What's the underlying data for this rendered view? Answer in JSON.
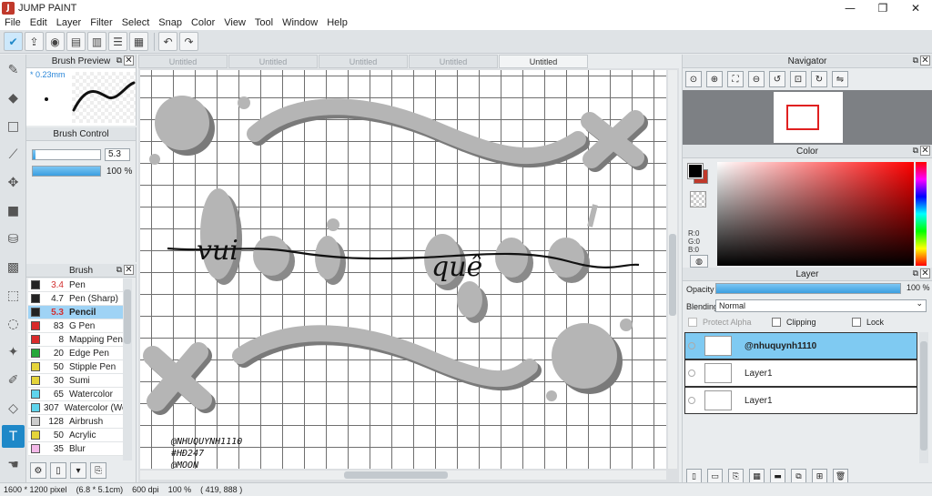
{
  "window": {
    "title": "JUMP PAINT",
    "controls": [
      "—",
      "❐",
      "✕"
    ]
  },
  "menu": [
    "File",
    "Edit",
    "Layer",
    "Filter",
    "Select",
    "Snap",
    "Color",
    "View",
    "Tool",
    "Window",
    "Help"
  ],
  "brush_preview": {
    "title": "Brush Preview",
    "size_label": "* 0.23mm"
  },
  "brush_control": {
    "title": "Brush Control",
    "size_value": "5.3",
    "opacity_value": "100 %"
  },
  "brush_list": {
    "title": "Brush",
    "items": [
      {
        "size": "3.4",
        "name": "Pen",
        "color": "#222222",
        "red": true
      },
      {
        "size": "4.7",
        "name": "Pen (Sharp)",
        "color": "#222222",
        "red": false
      },
      {
        "size": "5.3",
        "name": "Pencil",
        "color": "#222222",
        "red": true,
        "selected": true
      },
      {
        "size": "83",
        "name": "G Pen",
        "color": "#d92b2b",
        "red": false
      },
      {
        "size": "8",
        "name": "Mapping Pen",
        "color": "#d92b2b",
        "red": false
      },
      {
        "size": "20",
        "name": "Edge Pen",
        "color": "#25a83a",
        "red": false
      },
      {
        "size": "50",
        "name": "Stipple Pen",
        "color": "#e5d43a",
        "red": false
      },
      {
        "size": "30",
        "name": "Sumi",
        "color": "#e5d43a",
        "red": false
      },
      {
        "size": "65",
        "name": "Watercolor",
        "color": "#5fd4ec",
        "red": false
      },
      {
        "size": "307",
        "name": "Watercolor (We",
        "color": "#5fd4ec",
        "red": false
      },
      {
        "size": "128",
        "name": "Airbrush",
        "color": "#cccccc",
        "red": false
      },
      {
        "size": "50",
        "name": "Acrylic",
        "color": "#e5d43a",
        "red": false
      },
      {
        "size": "35",
        "name": "Blur",
        "color": "#f3b8e8",
        "red": false
      }
    ]
  },
  "tabs": [
    "Untitled",
    "Untitled",
    "Untitled",
    "Untitled",
    "Untitled"
  ],
  "active_tab": 4,
  "canvas": {
    "watermark": [
      "@NHUQUYNH1110",
      "#HĐ247",
      "@MOON"
    ],
    "art_text": [
      "vui",
      "quê"
    ]
  },
  "navigator": {
    "title": "Navigator"
  },
  "color_panel": {
    "title": "Color",
    "r": "R:0",
    "g": "G:0",
    "b": "B:0",
    "fg": "#000000",
    "bg": "#c0392b"
  },
  "layer_panel": {
    "title": "Layer",
    "opacity_label": "Opacity",
    "opacity_value": "100 %",
    "blending_label": "Blending",
    "blending_value": "Normal",
    "protect_alpha": "Protect Alpha",
    "clipping": "Clipping",
    "lock": "Lock",
    "layers": [
      {
        "name": "@nhuquynh1110",
        "selected": true
      },
      {
        "name": "Layer1",
        "selected": false
      },
      {
        "name": "Layer1",
        "selected": false
      }
    ]
  },
  "status": {
    "pixels": "1600 * 1200 pixel",
    "cm": "(6.8 * 5.1cm)",
    "dpi": "600 dpi",
    "zoom": "100 %",
    "coords": "( 419, 888 )"
  },
  "colors": {
    "accent": "#1e88c8",
    "selection": "#7fcaf2",
    "shape_gray": "#b5b5b5"
  }
}
